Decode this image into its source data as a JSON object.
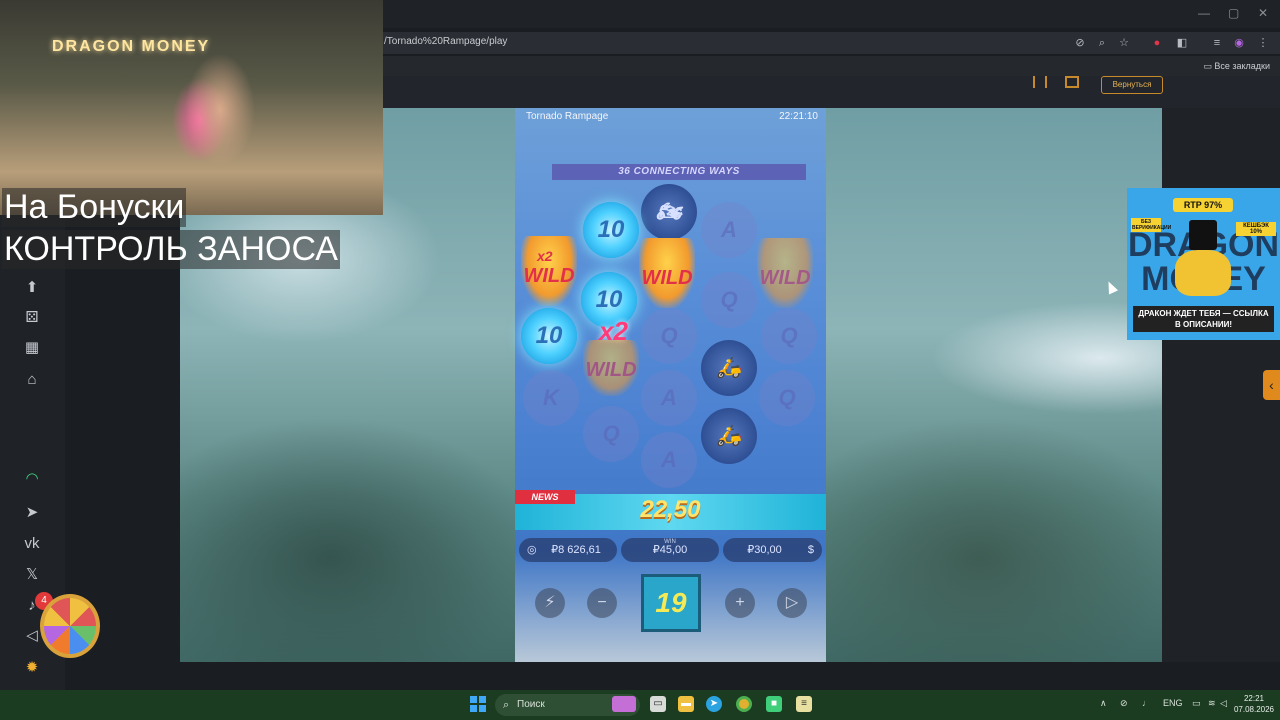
{
  "browser": {
    "url": "/Tornado%20Rampage/play",
    "bookmarks_all": "Все закладки",
    "win_controls": {
      "minimize": "—",
      "restore": "▢",
      "close": "✕"
    }
  },
  "site": {
    "return_label": "Вернуться"
  },
  "sidebar": {
    "notification_count": "4"
  },
  "game": {
    "title": "Tornado Rampage",
    "time": "22:21:10",
    "ways_banner": "36 CONNECTING WAYS",
    "symbols": {
      "ten": "10",
      "wild": "WILD",
      "multiplier": "x2",
      "multiplier_small": "x2",
      "a": "A",
      "q": "Q",
      "k": "K"
    },
    "news_label": "NEWS",
    "win_amount": "22,50",
    "balance": "₽8 626,61",
    "win_label": "WIN",
    "win_value": "₽45,00",
    "bet": "₽30,00",
    "spin_count": "19"
  },
  "stream_overlay": {
    "neon_sign": "DRAGON MONEY",
    "line1": "На Бонуски",
    "line2": "КОНТРОЛЬ ЗАНОСА"
  },
  "ad": {
    "rtp": "RTP 97%",
    "tag_left": "БЕЗ ВЕРИФИКАЦИИ",
    "tag_right": "КЕШБЭК 10%",
    "brand": "DRAGON MONEY",
    "cta": "ДРАКОН ЖДЕТ ТЕБЯ — ССЫЛКА В ОПИСАНИИ!"
  },
  "taskbar": {
    "search_placeholder": "Поиск",
    "lang": "ENG",
    "time": "22:21",
    "date": "07.08.2026"
  }
}
